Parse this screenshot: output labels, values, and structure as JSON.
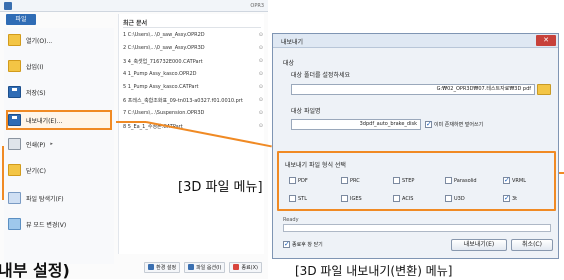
{
  "app": {
    "title": "OPR3"
  },
  "file_tab": "파일",
  "commands": [
    {
      "label": "열기(O)...",
      "icon": "open-folder-icon",
      "dropdown": false
    },
    {
      "label": "삽입(I)",
      "icon": "insert-folder-icon",
      "dropdown": false
    },
    {
      "label": "저장(S)",
      "icon": "save-icon",
      "dropdown": false
    },
    {
      "label": "내보내기(E)...",
      "icon": "export-icon",
      "dropdown": false
    },
    {
      "label": "인쇄(P)",
      "icon": "print-icon",
      "dropdown": true
    },
    {
      "label": "닫기(C)",
      "icon": "close-file-icon",
      "dropdown": false
    },
    {
      "label": "파일 탐색기(F)",
      "icon": "file-explorer-icon",
      "dropdown": false
    },
    {
      "label": "뷰 모드 변경(V)",
      "icon": "view-mode-icon",
      "dropdown": false
    }
  ],
  "recent": {
    "title": "최근 문서",
    "items": [
      "1 C:\\Users\\...\\0_saw_Assy.OPR2D",
      "2 C:\\Users\\...\\0_saw_Assy.OPR3D",
      "3 4_축셋업_716732E000.CATPart",
      "4 1_Pump Assy_kasco.OPR2D",
      "5 1_Pump Assy_kasco.CATPart",
      "6 프레스_축합조화표_09-tn013-a0327.f01.0010.prt",
      "7 C:\\Users\\...\\Suspension.OPR3D",
      "8 5_Ea_1_수정본.CATPart"
    ]
  },
  "footer": {
    "env_settings": "환경 설정",
    "file_options": "파일 옵션(I)",
    "exit": "종료(X)"
  },
  "menu_caption": "[3D 파일 메뉴]",
  "bottom_text": "내부 설정)",
  "dialog": {
    "title": "내보내기",
    "target_group": "대상",
    "select_folder_label": "대상 폴더를 설정하세요",
    "folder_path": "G:₩02_OPR3D₩07.테스트자료₩3D pdf",
    "file_name_label": "대상 파일명",
    "file_name_value": "3dpdf_auto_brake_disk",
    "overwrite_label": "이미 존재하면 덮어쓰기",
    "overwrite_checked": true,
    "format_group_title": "내보내기 파일 형식 선택",
    "formats": [
      {
        "label": "PDF",
        "checked": false
      },
      {
        "label": "PRC",
        "checked": false
      },
      {
        "label": "STEP",
        "checked": false
      },
      {
        "label": "Parasolid",
        "checked": false
      },
      {
        "label": "VRML",
        "checked": true
      },
      {
        "label": "STL",
        "checked": false
      },
      {
        "label": "IGES",
        "checked": false
      },
      {
        "label": "ACIS",
        "checked": false
      },
      {
        "label": "U3D",
        "checked": false
      },
      {
        "label": "3t",
        "checked": true
      }
    ],
    "status": "Ready",
    "progress": 0,
    "close_after_label": "종료후 창 닫기",
    "close_after_checked": true,
    "export_button": "내보내기(E)",
    "cancel_button": "취소(C)"
  },
  "dialog_caption": "[3D 파일 내보내기(변환) 메뉴]",
  "accent_color": "#f08a24"
}
